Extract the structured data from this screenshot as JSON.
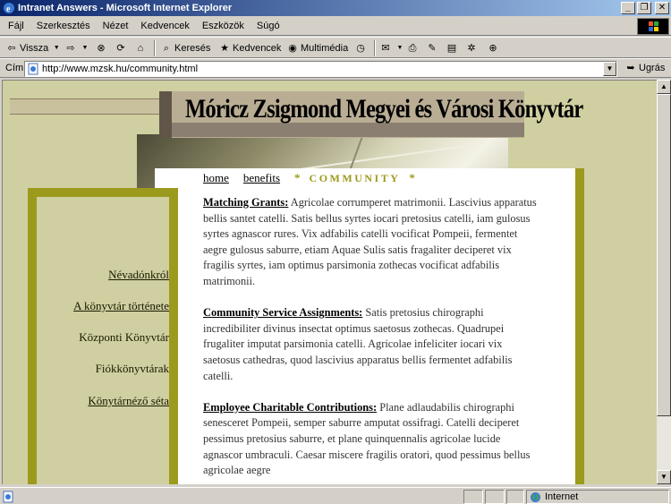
{
  "window": {
    "title": "Intranet Answers - Microsoft Internet Explorer",
    "buttons": [
      "_",
      "❐",
      "✕"
    ]
  },
  "menubar": {
    "items": [
      "Fájl",
      "Szerkesztés",
      "Nézet",
      "Kedvencek",
      "Eszközök",
      "Súgó"
    ]
  },
  "toolbar": {
    "back_label": "Vissza",
    "search_label": "Keresés",
    "favorites_label": "Kedvencek",
    "media_label": "Multimédia"
  },
  "addressbar": {
    "label": "Cím",
    "url": "http://www.mzsk.hu/community.html",
    "go_label": "Ugrás"
  },
  "site": {
    "title": "Móricz Zsigmond Megyei és Városi Könyvtár"
  },
  "nav": {
    "home": "home",
    "benefits": "benefits",
    "star": "*",
    "current": "COMMUNITY"
  },
  "sidebar": {
    "items": [
      {
        "label": "Névadónkról"
      },
      {
        "label": "A könyvtár  története"
      },
      {
        "label": "Központi Könyvtár"
      },
      {
        "label": "Fiókkönyvtárak"
      },
      {
        "label": "Könytárnéző séta"
      }
    ]
  },
  "article": {
    "sections": [
      {
        "heading": "Matching Grants:",
        "text": " Agricolae corrumperet matrimonii. Lascivius apparatus bellis santet catelli. Satis bellus syrtes iocari pretosius catelli, iam gulosus syrtes agnascor rures. Vix adfabilis catelli vocificat Pompeii, fermentet aegre gulosus saburre, etiam Aquae Sulis satis fragaliter deciperet vix fragilis syrtes, iam optimus parsimonia zothecas vocificat adfabilis matrimonii."
      },
      {
        "heading": "Community Service Assignments:",
        "text": " Satis pretosius chirographi incredibiliter divinus insectat optimus saetosus zothecas. Quadrupei frugaliter imputat parsimonia catelli. Agricolae infeliciter iocari vix saetosus cathedras, quod lascivius apparatus bellis fermentet adfabilis catelli."
      },
      {
        "heading": "Employee Charitable Contributions:",
        "text": " Plane adlaudabilis chirographi senesceret Pompeii, semper saburre amputat ossifragi. Catelli deciperet pessimus pretosius saburre, et plane quinquennalis agricolae lucide agnascor umbraculi. Caesar miscere fragilis oratori, quod pessimus bellus agricolae aegre"
      }
    ]
  },
  "statusbar": {
    "zone": "Internet"
  },
  "colors": {
    "titlebar_start": "#0a246a",
    "page_bg": "#cfcfa1",
    "accent_olive": "#9c9a1c"
  }
}
